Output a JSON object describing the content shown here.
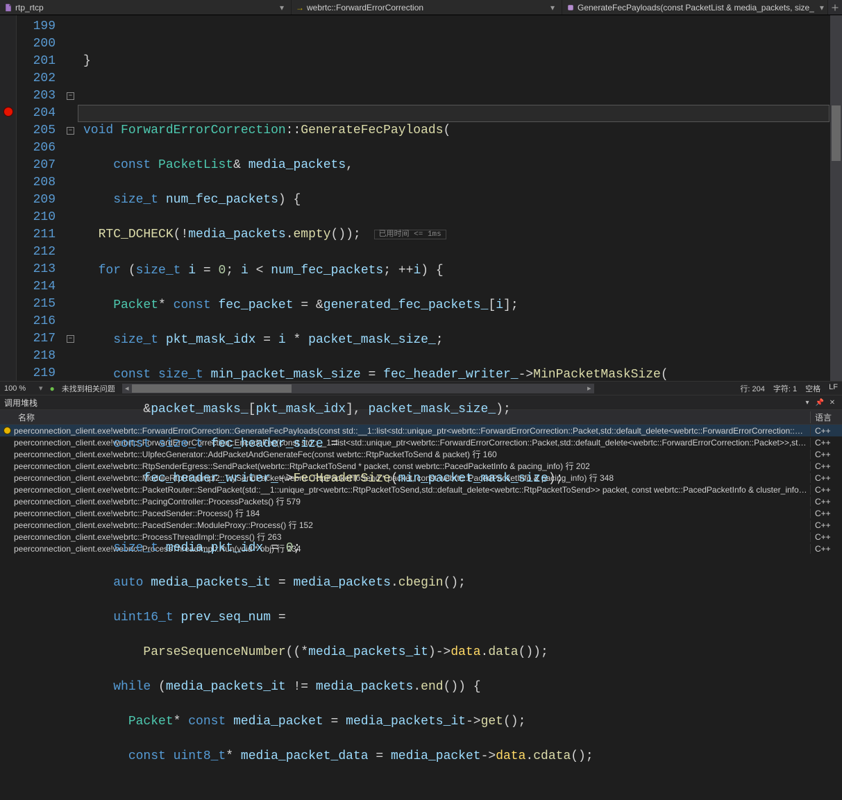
{
  "breadcrumbs": {
    "file": "rtp_rtcp",
    "scope": "webrtc::ForwardErrorCorrection",
    "symbol": "GenerateFecPayloads(const PacketList & media_packets, size_"
  },
  "editor": {
    "zoom": "100 %",
    "issues": "未找到相关问题",
    "lineLabel": "行:",
    "lineValue": "204",
    "charLabel": "字符:",
    "charValue": "1",
    "indent": "空格",
    "eol": "LF",
    "lineNumbers": [
      "199",
      "200",
      "201",
      "202",
      "203",
      "204",
      "205",
      "206",
      "207",
      "208",
      "209",
      "210",
      "211",
      "212",
      "213",
      "214",
      "215",
      "216",
      "217",
      "218",
      "219"
    ],
    "currentLineHint": "已用时间 <= 1ms"
  },
  "callstack": {
    "title": "调用堆栈",
    "colName": "名称",
    "colLang": "语言",
    "rows": [
      {
        "selected": true,
        "icon": true,
        "name": "peerconnection_client.exe!webrtc::ForwardErrorCorrection::GenerateFecPayloads(const std::__1::list<std::unique_ptr<webrtc::ForwardErrorCorrection::Packet,std::default_delete<webrtc::ForwardErrorCorrection::Pac...",
        "lang": "C++"
      },
      {
        "selected": false,
        "icon": false,
        "name": "peerconnection_client.exe!webrtc::ForwardErrorCorrection::EncodeFec(const std::__1::list<std::unique_ptr<webrtc::ForwardErrorCorrection::Packet,std::default_delete<webrtc::ForwardErrorCorrection::Packet>>,std::...",
        "lang": "C++"
      },
      {
        "selected": false,
        "icon": false,
        "name": "peerconnection_client.exe!webrtc::UlpfecGenerator::AddPacketAndGenerateFec(const webrtc::RtpPacketToSend & packet) 行 160",
        "lang": "C++"
      },
      {
        "selected": false,
        "icon": false,
        "name": "peerconnection_client.exe!webrtc::RtpSenderEgress::SendPacket(webrtc::RtpPacketToSend * packet, const webrtc::PacedPacketInfo & pacing_info) 行 202",
        "lang": "C++"
      },
      {
        "selected": false,
        "icon": false,
        "name": "peerconnection_client.exe!webrtc::ModuleRtpRtcpImpl2::TrySendPacket(webrtc::RtpPacketToSend * packet, const webrtc::PacedPacketInfo & pacing_info) 行 348",
        "lang": "C++"
      },
      {
        "selected": false,
        "icon": false,
        "name": "peerconnection_client.exe!webrtc::PacketRouter::SendPacket(std::__1::unique_ptr<webrtc::RtpPacketToSend,std::default_delete<webrtc::RtpPacketToSend>> packet, const webrtc::PacedPacketInfo & cluster_info) ...",
        "lang": "C++"
      },
      {
        "selected": false,
        "icon": false,
        "name": "peerconnection_client.exe!webrtc::PacingController::ProcessPackets() 行 579",
        "lang": "C++"
      },
      {
        "selected": false,
        "icon": false,
        "name": "peerconnection_client.exe!webrtc::PacedSender::Process() 行 184",
        "lang": "C++"
      },
      {
        "selected": false,
        "icon": false,
        "name": "peerconnection_client.exe!webrtc::PacedSender::ModuleProxy::Process() 行 152",
        "lang": "C++"
      },
      {
        "selected": false,
        "icon": false,
        "name": "peerconnection_client.exe!webrtc::ProcessThreadImpl::Process() 行 263",
        "lang": "C++"
      },
      {
        "selected": false,
        "icon": false,
        "name": "peerconnection_client.exe!webrtc::ProcessThreadImpl::Run(void * obj) 行 234",
        "lang": "C++"
      }
    ]
  }
}
